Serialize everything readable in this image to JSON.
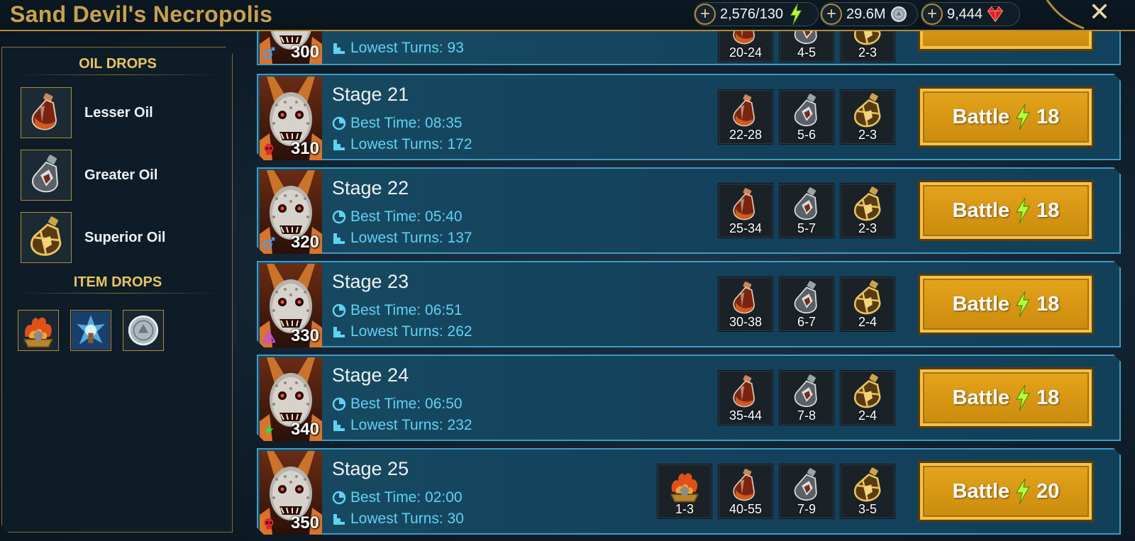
{
  "header": {
    "title": "Sand Devil's Necropolis",
    "energy": "2,576/130",
    "silver": "29.6M",
    "gems": "9,444",
    "close_label": "✕"
  },
  "sidebar": {
    "oil_title": "OIL DROPS",
    "oils": [
      {
        "label": "Lesser Oil"
      },
      {
        "label": "Greater Oil"
      },
      {
        "label": "Superior Oil"
      }
    ],
    "item_title": "ITEM DROPS"
  },
  "partial_stage": {
    "level": "300",
    "lowest_turns": "Lowest Turns: 93",
    "rewards": [
      "20-24",
      "4-5",
      "2-3"
    ]
  },
  "stages": [
    {
      "name": "Stage 21",
      "level": "310",
      "affinity": "force",
      "best_time": "Best Time: 08:35",
      "lowest_turns": "Lowest Turns: 172",
      "rewards": [
        "22-28",
        "5-6",
        "2-3"
      ],
      "battle_label": "Battle",
      "cost": "18"
    },
    {
      "name": "Stage 22",
      "level": "320",
      "affinity": "magic",
      "best_time": "Best Time: 05:40",
      "lowest_turns": "Lowest Turns: 137",
      "rewards": [
        "25-34",
        "5-7",
        "2-3"
      ],
      "battle_label": "Battle",
      "cost": "18"
    },
    {
      "name": "Stage 23",
      "level": "330",
      "affinity": "void",
      "best_time": "Best Time: 06:51",
      "lowest_turns": "Lowest Turns: 262",
      "rewards": [
        "30-38",
        "6-7",
        "2-4"
      ],
      "battle_label": "Battle",
      "cost": "18"
    },
    {
      "name": "Stage 24",
      "level": "340",
      "affinity": "spirit",
      "best_time": "Best Time: 06:50",
      "lowest_turns": "Lowest Turns: 232",
      "rewards": [
        "35-44",
        "7-8",
        "2-4"
      ],
      "battle_label": "Battle",
      "cost": "18"
    },
    {
      "name": "Stage 25",
      "level": "350",
      "affinity": "force",
      "best_time": "Best Time: 02:00",
      "lowest_turns": "Lowest Turns: 30",
      "item_reward": "1-3",
      "rewards": [
        "40-55",
        "7-9",
        "3-5"
      ],
      "battle_label": "Battle",
      "cost": "20"
    }
  ],
  "colors": {
    "accent_gold": "#c9a04c",
    "row_border": "#3f9bc3",
    "stat_text": "#5fd2f2",
    "battle_button": "#e6a51c"
  }
}
